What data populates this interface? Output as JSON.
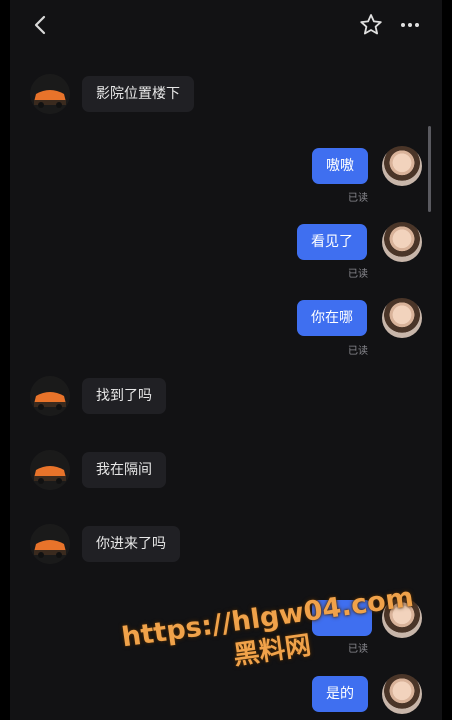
{
  "chat": {
    "peek_text": "",
    "messages": [
      {
        "side": "in",
        "text": "影院位置楼下"
      },
      {
        "side": "out",
        "text": "嗷嗷",
        "status": "已读"
      },
      {
        "side": "out",
        "text": "看见了",
        "status": "已读"
      },
      {
        "side": "out",
        "text": "你在哪",
        "status": "已读"
      },
      {
        "side": "in",
        "text": "找到了吗"
      },
      {
        "side": "in",
        "text": "我在隔间"
      },
      {
        "side": "in",
        "text": "你进来了吗"
      },
      {
        "side": "out",
        "text": "",
        "status": "已读"
      },
      {
        "side": "out",
        "text": "是的"
      }
    ]
  },
  "watermark": {
    "line1": "https://hlgw04.com",
    "line2": "黑料网"
  },
  "icons": {
    "back": "chevron-left-icon",
    "favorite": "star-icon",
    "more": "more-dots-icon"
  },
  "colors": {
    "background": "#121214",
    "incoming_bubble": "#202024",
    "outgoing_bubble": "#3f6ff0",
    "watermark": "#f0a24a"
  }
}
